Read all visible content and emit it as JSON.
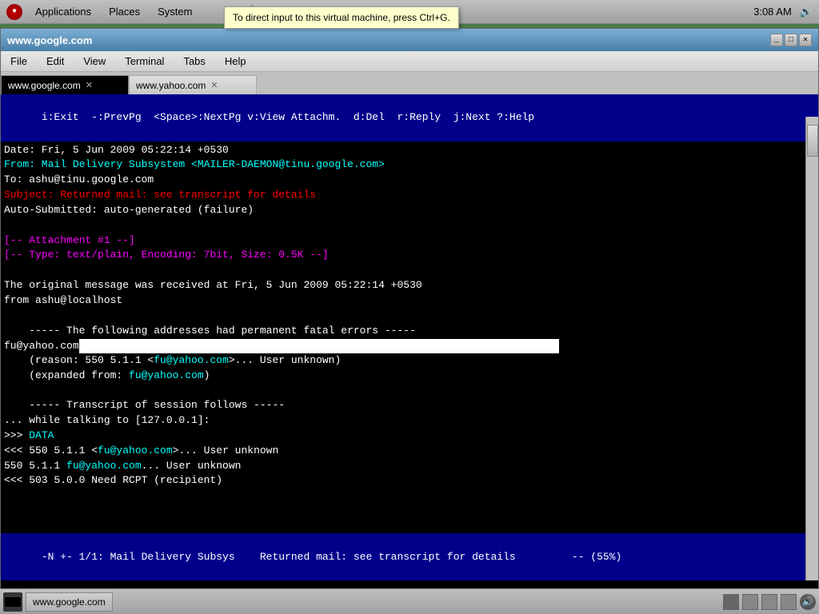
{
  "system_bar": {
    "apps_label": "Applications",
    "places_label": "Places",
    "system_label": "System",
    "time": "3:08 AM"
  },
  "tooltip": {
    "text": "To direct input to this virtual machine, press Ctrl+G."
  },
  "terminal": {
    "title": "www.google.com",
    "tabs": [
      {
        "label": "www.google.com",
        "active": true
      },
      {
        "label": "www.yahoo.com",
        "active": false
      }
    ],
    "menu_items": [
      "File",
      "Edit",
      "View",
      "Terminal",
      "Tabs",
      "Help"
    ],
    "status_top": "i:Exit  -:PrevPg  <Space>:NextPg v:View Attachm.  d:Del  r:Reply  j:Next ?:Help",
    "content_lines": [
      {
        "text": "Date: Fri, 5 Jun 2009 05:22:14 +0530",
        "color": "white"
      },
      {
        "text": "From: Mail Delivery Subsystem <MAILER-DAEMON@tinu.google.com>",
        "color": "cyan"
      },
      {
        "text": "To: ashu@tinu.google.com",
        "color": "white"
      },
      {
        "text": "Subject: Returned mail: see transcript for details",
        "color": "red"
      },
      {
        "text": "Auto-Submitted: auto-generated (failure)",
        "color": "white"
      },
      {
        "text": "",
        "color": "white"
      },
      {
        "text": "[-- Attachment #1 --]",
        "color": "magenta"
      },
      {
        "text": "[-- Type: text/plain, Encoding: 7bit, Size: 0.5K --]",
        "color": "magenta"
      },
      {
        "text": "",
        "color": "white"
      },
      {
        "text": "The original message was received at Fri, 5 Jun 2009 05:22:14 +0530",
        "color": "white"
      },
      {
        "text": "from ashu@localhost",
        "color": "white"
      },
      {
        "text": "",
        "color": "white"
      },
      {
        "text": "    ----- The following addresses had permanent fatal errors -----",
        "color": "white"
      },
      {
        "text": "fu@yahoo.com",
        "color": "white",
        "selected": true
      },
      {
        "text": "    (reason: 550 5.1.1 <fu@yahoo.com>... User unknown)",
        "color": "white",
        "parts": [
          {
            "text": "    (reason: 550 5.1.1 <",
            "color": "white"
          },
          {
            "text": "fu@yahoo.com",
            "color": "cyan"
          },
          {
            "text": ">... User unknown)",
            "color": "white"
          }
        ]
      },
      {
        "text": "    (expanded from: fu@yahoo.com)",
        "color": "white",
        "parts": [
          {
            "text": "    (expanded from: ",
            "color": "white"
          },
          {
            "text": "fu@yahoo.com",
            "color": "cyan"
          },
          {
            "text": ")",
            "color": "white"
          }
        ]
      },
      {
        "text": "",
        "color": "white"
      },
      {
        "text": "    ----- Transcript of session follows -----",
        "color": "white"
      },
      {
        "text": "... while talking to [127.0.0.1]:",
        "color": "white"
      },
      {
        "text": ">>> DATA",
        "color": "cyan",
        "parts": [
          {
            "text": ">>> ",
            "color": "white"
          },
          {
            "text": "DATA",
            "color": "cyan"
          }
        ]
      },
      {
        "text": "<<< 550 5.1.1 <fu@yahoo.com>... User unknown",
        "color": "white",
        "parts": [
          {
            "text": "<<< 550 5.1.1 <",
            "color": "white"
          },
          {
            "text": "fu@yahoo.com",
            "color": "cyan"
          },
          {
            "text": ">... User unknown",
            "color": "white"
          }
        ]
      },
      {
        "text": "550 5.1.1 fu@yahoo.com... User unknown",
        "color": "white",
        "parts": [
          {
            "text": "550 5.1.1 ",
            "color": "white"
          },
          {
            "text": "fu@yahoo.com",
            "color": "cyan"
          },
          {
            "text": "... User unknown",
            "color": "white"
          }
        ]
      },
      {
        "text": "<<< 503 5.0.0 Need RCPT (recipient)",
        "color": "white"
      }
    ],
    "status_bottom": "-N +- 1/1: Mail Delivery Subsys    Returned mail: see transcript for details         -- (55%)"
  },
  "taskbar": {
    "btn_label": "www.google.com",
    "squares": [
      "sq1",
      "sq2",
      "sq3",
      "sq4"
    ]
  }
}
